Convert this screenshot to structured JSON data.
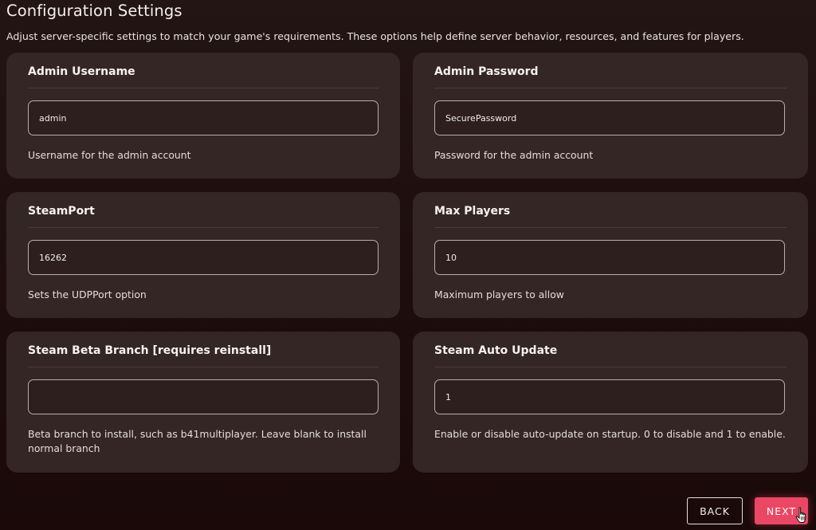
{
  "header": {
    "title": "Configuration Settings",
    "description": "Adjust server-specific settings to match your game's requirements. These options help define server behavior, resources, and features for players."
  },
  "settings": [
    {
      "title": "Admin Username",
      "value": "admin",
      "placeholder": "",
      "help": "Username for the admin account"
    },
    {
      "title": "Admin Password",
      "value": "SecurePassword",
      "placeholder": "",
      "help": "Password for the admin account"
    },
    {
      "title": "SteamPort",
      "value": "16262",
      "placeholder": "",
      "help": "Sets the UDPPort option"
    },
    {
      "title": "Max Players",
      "value": "10",
      "placeholder": "",
      "help": "Maximum players to allow"
    },
    {
      "title": "Steam Beta Branch [requires reinstall]",
      "value": "",
      "placeholder": "",
      "help": "Beta branch to install, such as b41multiplayer. Leave blank to install normal branch"
    },
    {
      "title": "Steam Auto Update",
      "value": "1",
      "placeholder": "",
      "help": "Enable or disable auto-update on startup. 0 to disable and 1 to enable."
    }
  ],
  "footer": {
    "back_label": "BACK",
    "next_label": "NEXT"
  },
  "colors": {
    "accent": "#e94763",
    "card": "#342624",
    "background": "#1d0e0d"
  },
  "icons": {
    "cursor": "hand-pointer-icon"
  }
}
